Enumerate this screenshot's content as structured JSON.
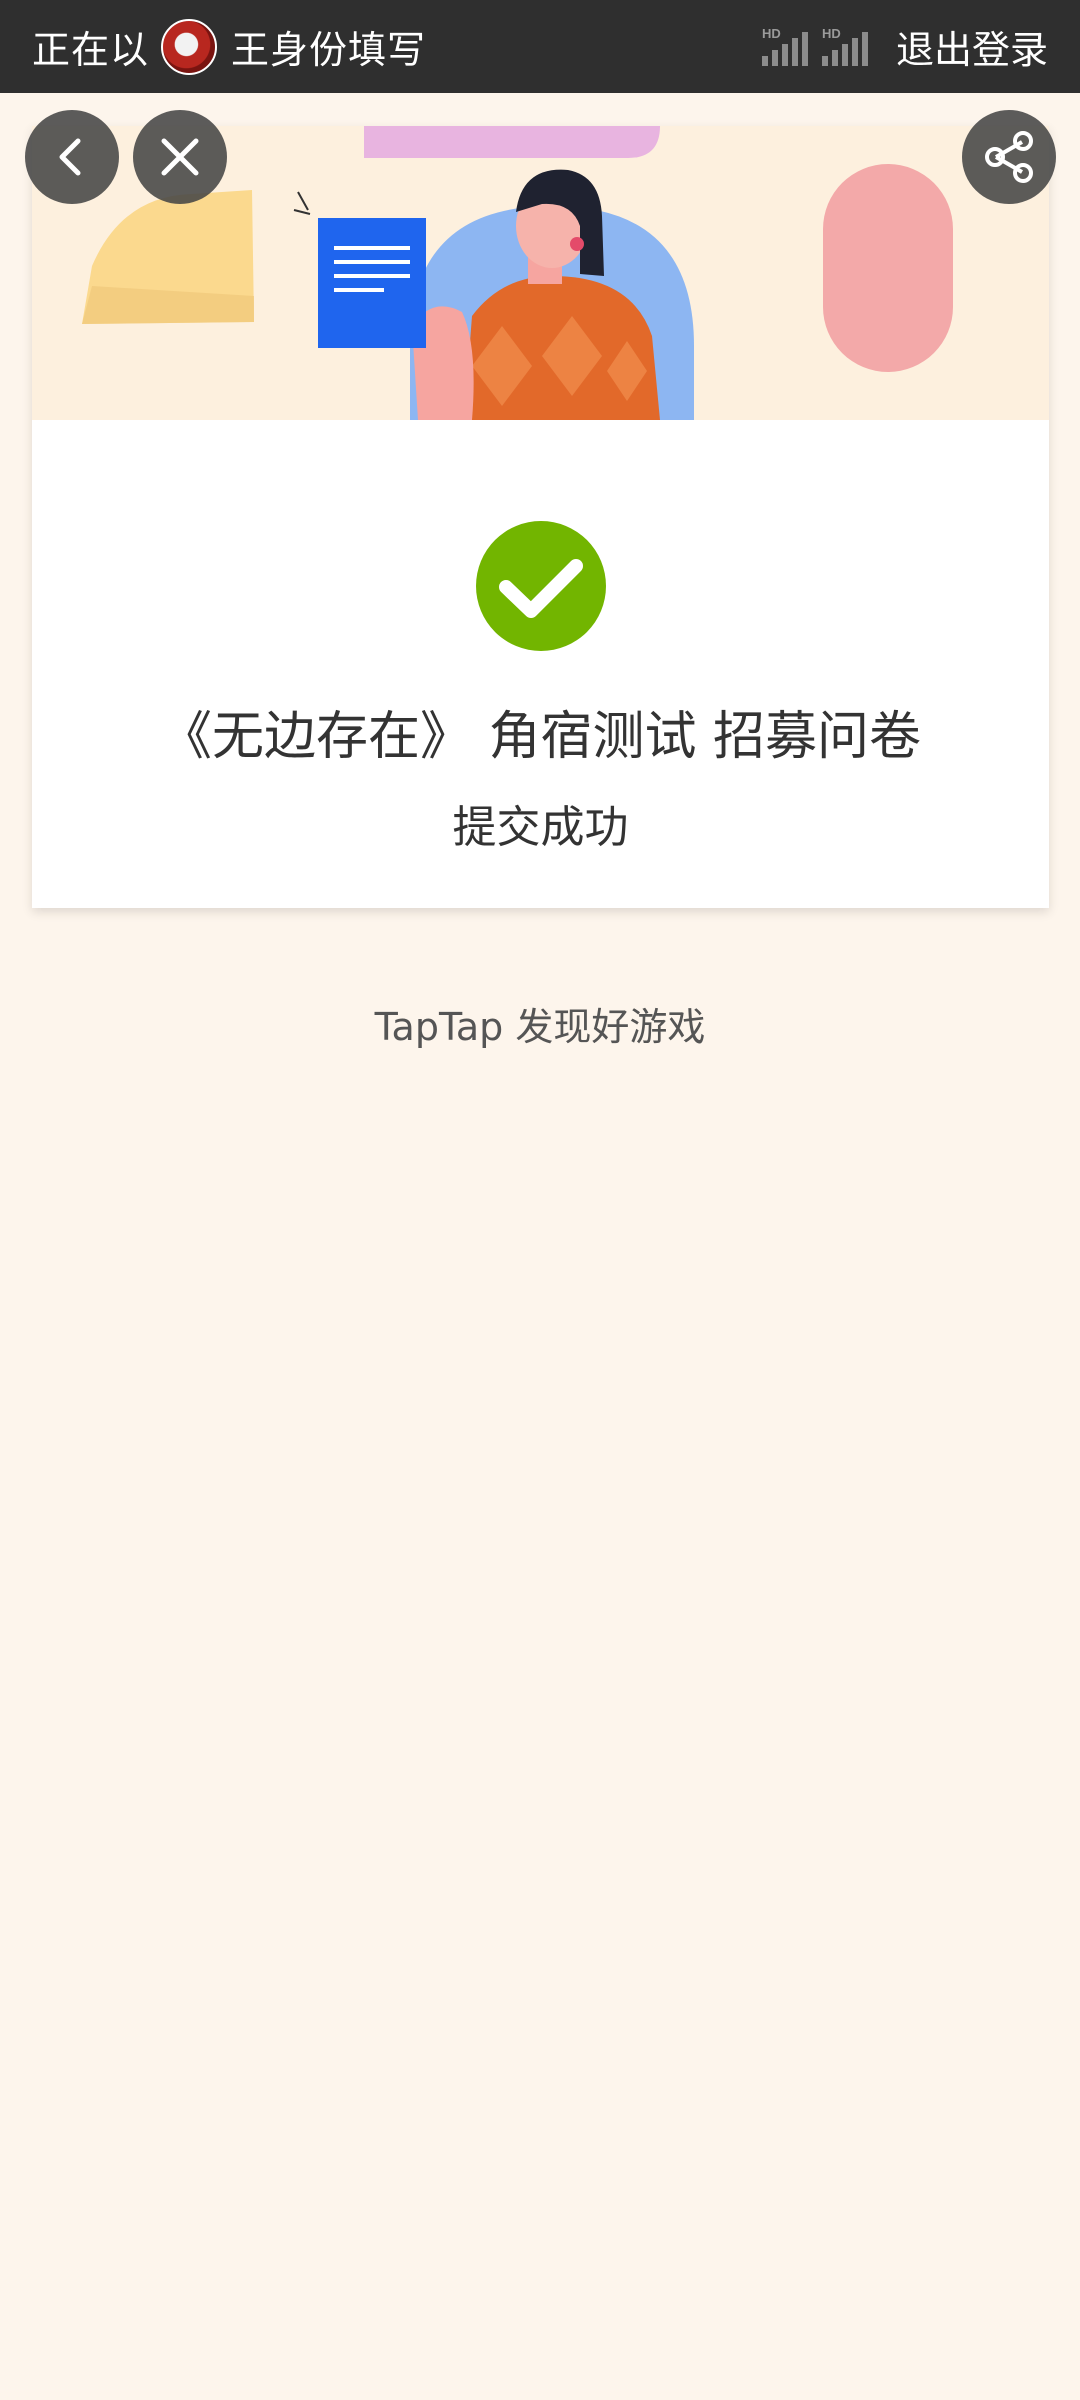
{
  "topbar": {
    "prefix": "正在以",
    "identity_suffix": "王身份填写",
    "logout_label": "退出登录",
    "network_badge_1": "HD",
    "network_badge_2": "HD"
  },
  "nav": {
    "back_icon": "chevron-left-icon",
    "close_icon": "close-icon",
    "share_icon": "share-icon"
  },
  "result": {
    "title": "《无边存在》 角宿测试 招募问卷",
    "status": "提交成功",
    "success_color": "#72b500"
  },
  "footer": {
    "slogan": "TapTap 发现好游戏"
  },
  "colors": {
    "page_background": "#fdf5ec",
    "topbar_background": "#2f2f2f",
    "banner_background": "#fdf0de"
  }
}
